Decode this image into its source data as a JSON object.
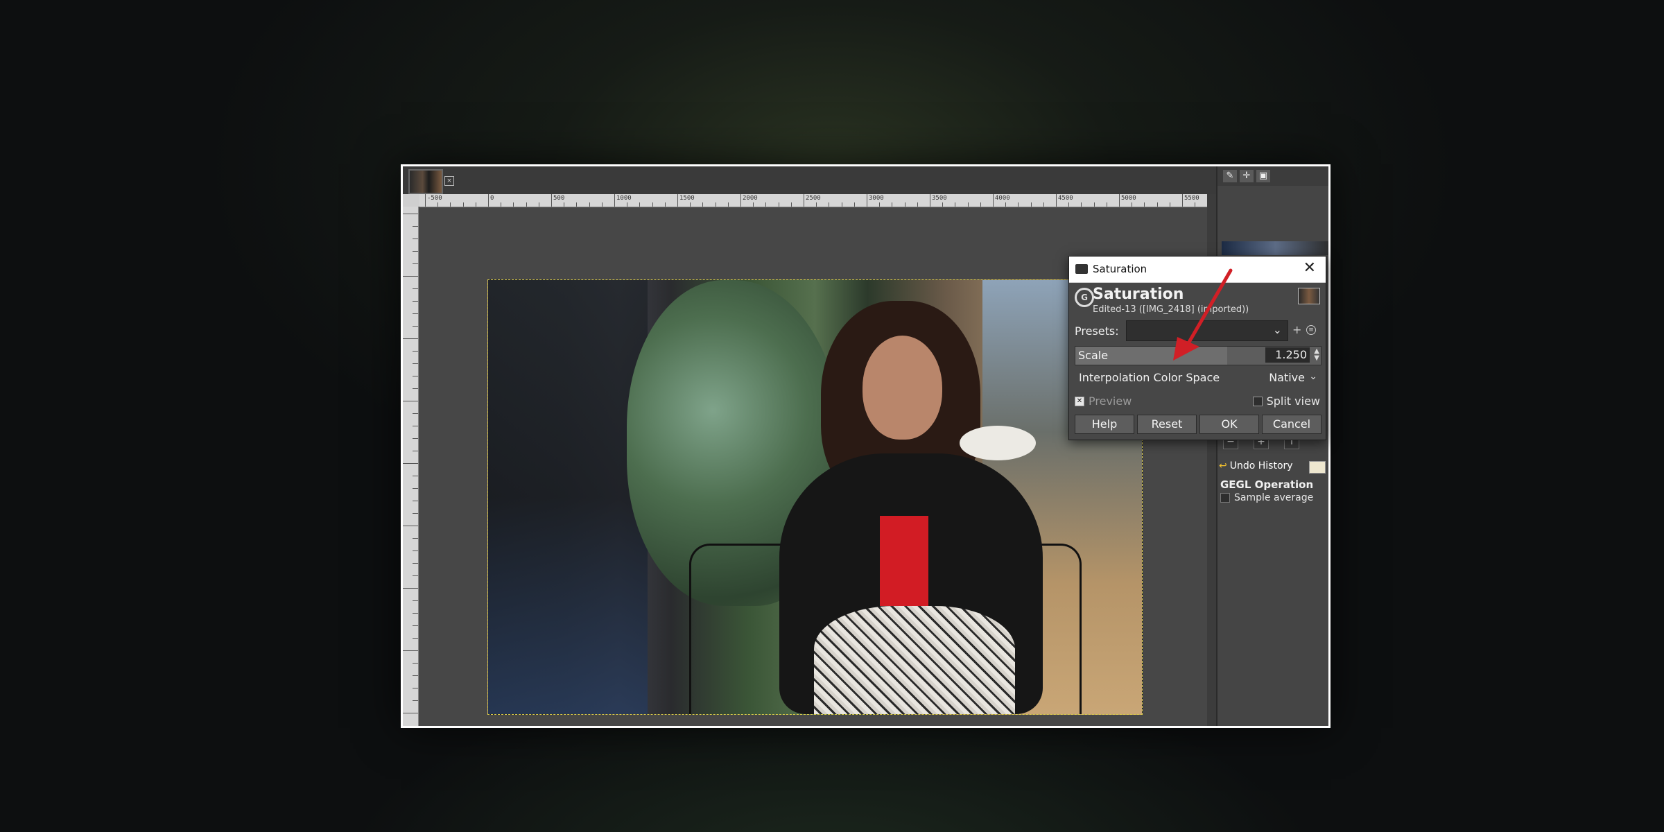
{
  "colors": {
    "accent_arrow": "#d11f26",
    "selection_border": "#d8c94a"
  },
  "dialog": {
    "window_title": "Saturation",
    "heading": "Saturation",
    "subtitle": "Edited-13 ([IMG_2418] (imported))",
    "presets_label": "Presets:",
    "presets_value": "",
    "scale_label": "Scale",
    "scale_value": "1.250",
    "scale_fraction": 0.62,
    "interp_label": "Interpolation Color Space",
    "interp_value": "Native",
    "preview_label": "Preview",
    "preview_checked": true,
    "split_label": "Split view",
    "split_checked": false,
    "buttons": {
      "help": "Help",
      "reset": "Reset",
      "ok": "OK",
      "cancel": "Cancel"
    },
    "close_glyph": "✕"
  },
  "ruler": {
    "labels": [
      "-500",
      "0",
      "500",
      "1000",
      "1500",
      "2000",
      "2500",
      "3000",
      "3500",
      "4000",
      "4500",
      "5000",
      "5500"
    ]
  },
  "right_panel": {
    "undo_history_label": "Undo History",
    "gegl_label": "GEGL Operation",
    "sample_label": "Sample average"
  },
  "icons": {
    "tab_close": "close-icon",
    "tools": "brush-tools-icon",
    "move": "move-icon",
    "image": "image-icon"
  }
}
